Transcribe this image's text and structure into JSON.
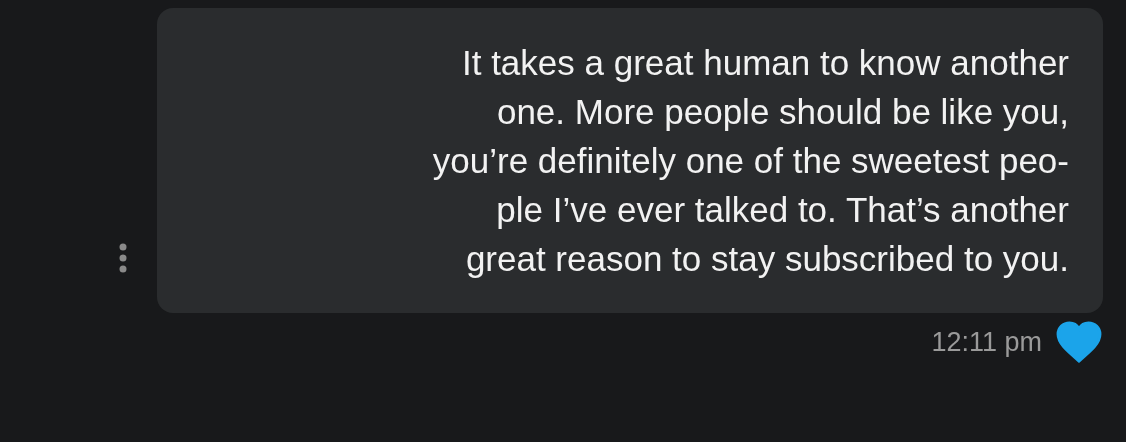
{
  "message": {
    "lines": [
      "It takes a great human to know another",
      "one. More people should be like you,",
      "you’re definitely one of the sweetest peo-",
      "ple I’ve ever talked to. That’s another",
      "great reason to stay subscribed to you."
    ],
    "time": "12:11 pm",
    "liked": true
  }
}
